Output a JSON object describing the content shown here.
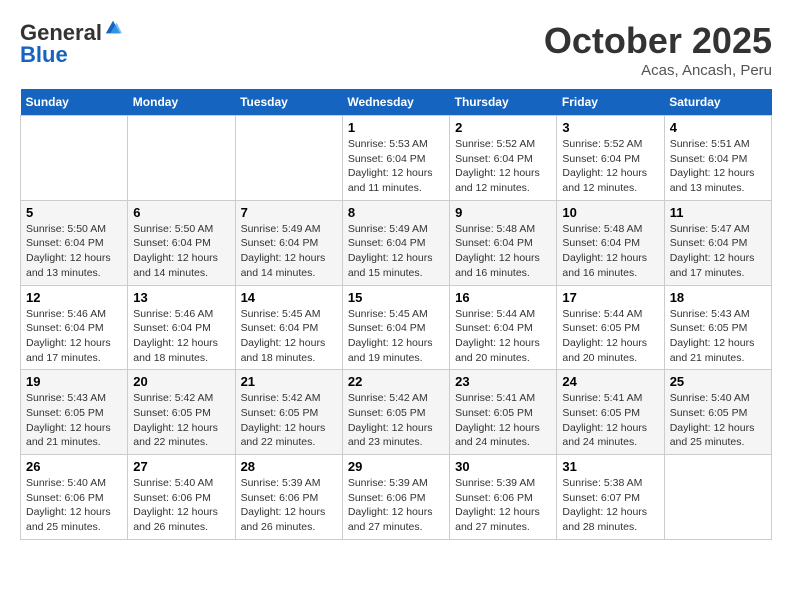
{
  "header": {
    "logo_line1": "General",
    "logo_line2": "Blue",
    "month": "October 2025",
    "location": "Acas, Ancash, Peru"
  },
  "weekdays": [
    "Sunday",
    "Monday",
    "Tuesday",
    "Wednesday",
    "Thursday",
    "Friday",
    "Saturday"
  ],
  "weeks": [
    [
      {
        "day": "",
        "info": ""
      },
      {
        "day": "",
        "info": ""
      },
      {
        "day": "",
        "info": ""
      },
      {
        "day": "1",
        "info": "Sunrise: 5:53 AM\nSunset: 6:04 PM\nDaylight: 12 hours and 11 minutes."
      },
      {
        "day": "2",
        "info": "Sunrise: 5:52 AM\nSunset: 6:04 PM\nDaylight: 12 hours and 12 minutes."
      },
      {
        "day": "3",
        "info": "Sunrise: 5:52 AM\nSunset: 6:04 PM\nDaylight: 12 hours and 12 minutes."
      },
      {
        "day": "4",
        "info": "Sunrise: 5:51 AM\nSunset: 6:04 PM\nDaylight: 12 hours and 13 minutes."
      }
    ],
    [
      {
        "day": "5",
        "info": "Sunrise: 5:50 AM\nSunset: 6:04 PM\nDaylight: 12 hours and 13 minutes."
      },
      {
        "day": "6",
        "info": "Sunrise: 5:50 AM\nSunset: 6:04 PM\nDaylight: 12 hours and 14 minutes."
      },
      {
        "day": "7",
        "info": "Sunrise: 5:49 AM\nSunset: 6:04 PM\nDaylight: 12 hours and 14 minutes."
      },
      {
        "day": "8",
        "info": "Sunrise: 5:49 AM\nSunset: 6:04 PM\nDaylight: 12 hours and 15 minutes."
      },
      {
        "day": "9",
        "info": "Sunrise: 5:48 AM\nSunset: 6:04 PM\nDaylight: 12 hours and 16 minutes."
      },
      {
        "day": "10",
        "info": "Sunrise: 5:48 AM\nSunset: 6:04 PM\nDaylight: 12 hours and 16 minutes."
      },
      {
        "day": "11",
        "info": "Sunrise: 5:47 AM\nSunset: 6:04 PM\nDaylight: 12 hours and 17 minutes."
      }
    ],
    [
      {
        "day": "12",
        "info": "Sunrise: 5:46 AM\nSunset: 6:04 PM\nDaylight: 12 hours and 17 minutes."
      },
      {
        "day": "13",
        "info": "Sunrise: 5:46 AM\nSunset: 6:04 PM\nDaylight: 12 hours and 18 minutes."
      },
      {
        "day": "14",
        "info": "Sunrise: 5:45 AM\nSunset: 6:04 PM\nDaylight: 12 hours and 18 minutes."
      },
      {
        "day": "15",
        "info": "Sunrise: 5:45 AM\nSunset: 6:04 PM\nDaylight: 12 hours and 19 minutes."
      },
      {
        "day": "16",
        "info": "Sunrise: 5:44 AM\nSunset: 6:04 PM\nDaylight: 12 hours and 20 minutes."
      },
      {
        "day": "17",
        "info": "Sunrise: 5:44 AM\nSunset: 6:05 PM\nDaylight: 12 hours and 20 minutes."
      },
      {
        "day": "18",
        "info": "Sunrise: 5:43 AM\nSunset: 6:05 PM\nDaylight: 12 hours and 21 minutes."
      }
    ],
    [
      {
        "day": "19",
        "info": "Sunrise: 5:43 AM\nSunset: 6:05 PM\nDaylight: 12 hours and 21 minutes."
      },
      {
        "day": "20",
        "info": "Sunrise: 5:42 AM\nSunset: 6:05 PM\nDaylight: 12 hours and 22 minutes."
      },
      {
        "day": "21",
        "info": "Sunrise: 5:42 AM\nSunset: 6:05 PM\nDaylight: 12 hours and 22 minutes."
      },
      {
        "day": "22",
        "info": "Sunrise: 5:42 AM\nSunset: 6:05 PM\nDaylight: 12 hours and 23 minutes."
      },
      {
        "day": "23",
        "info": "Sunrise: 5:41 AM\nSunset: 6:05 PM\nDaylight: 12 hours and 24 minutes."
      },
      {
        "day": "24",
        "info": "Sunrise: 5:41 AM\nSunset: 6:05 PM\nDaylight: 12 hours and 24 minutes."
      },
      {
        "day": "25",
        "info": "Sunrise: 5:40 AM\nSunset: 6:05 PM\nDaylight: 12 hours and 25 minutes."
      }
    ],
    [
      {
        "day": "26",
        "info": "Sunrise: 5:40 AM\nSunset: 6:06 PM\nDaylight: 12 hours and 25 minutes."
      },
      {
        "day": "27",
        "info": "Sunrise: 5:40 AM\nSunset: 6:06 PM\nDaylight: 12 hours and 26 minutes."
      },
      {
        "day": "28",
        "info": "Sunrise: 5:39 AM\nSunset: 6:06 PM\nDaylight: 12 hours and 26 minutes."
      },
      {
        "day": "29",
        "info": "Sunrise: 5:39 AM\nSunset: 6:06 PM\nDaylight: 12 hours and 27 minutes."
      },
      {
        "day": "30",
        "info": "Sunrise: 5:39 AM\nSunset: 6:06 PM\nDaylight: 12 hours and 27 minutes."
      },
      {
        "day": "31",
        "info": "Sunrise: 5:38 AM\nSunset: 6:07 PM\nDaylight: 12 hours and 28 minutes."
      },
      {
        "day": "",
        "info": ""
      }
    ]
  ]
}
